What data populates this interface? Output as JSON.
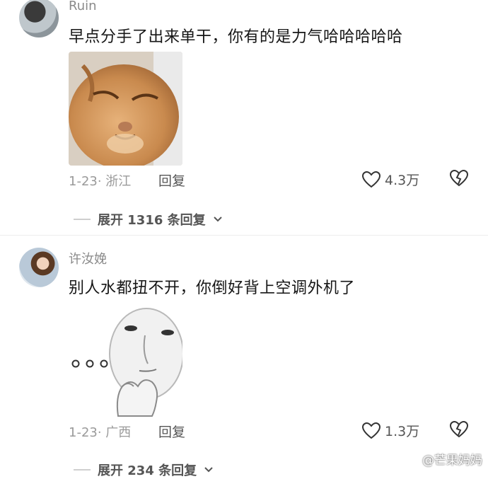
{
  "comments": [
    {
      "username": "Ruin",
      "text": "早点分手了出来单干，你有的是力气哈哈哈哈哈",
      "sticker_icon": "cat-smiling-sticker",
      "date_location": "1-23· 浙江",
      "reply_label": "回复",
      "likes": "4.3万",
      "expand_label": "展开 1316 条回复"
    },
    {
      "username": "许汝娩",
      "text": "别人水都扭不开，你倒好背上空调外机了",
      "sticker_icon": "thinking-face-sticker",
      "date_location": "1-23· 广西",
      "reply_label": "回复",
      "likes": "1.3万",
      "expand_label": "展开 234 条回复"
    }
  ],
  "watermark": "@芒果妈妈"
}
